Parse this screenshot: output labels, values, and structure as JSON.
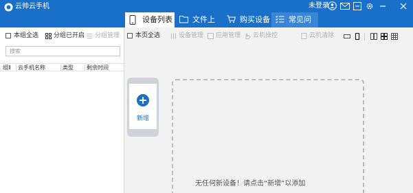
{
  "window": {
    "title": "云帅云手机",
    "login_text": "未登录"
  },
  "tabs": [
    {
      "label": "设备列表",
      "icon": "phone-icon",
      "active": true
    },
    {
      "label": "文件上传",
      "icon": "folder-icon",
      "active": false
    },
    {
      "label": "购买设备",
      "icon": "cart-icon",
      "active": false
    },
    {
      "label": "常见问题",
      "icon": "checklist-icon",
      "active": false
    }
  ],
  "left_panel": {
    "select_all": "本组全选",
    "group_opened": "分组已开启",
    "group_manage": "分组管理",
    "search_placeholder": "搜索",
    "columns": [
      "组Ⅱ",
      "云手机名称",
      "类型",
      "剩余时间"
    ]
  },
  "main_toolbar": {
    "select_page": "本页全选",
    "device_manage": "设备管理",
    "app_manage": "应用管理",
    "cloud_control": "云机操控",
    "cloud_clean": "云机清除"
  },
  "empty_state": {
    "new_label": "新增",
    "message": "无任何新设备！请点击“新增”以添加"
  },
  "colors": {
    "titlebar": "#1a6fc9",
    "accent": "#1a6fc9"
  }
}
